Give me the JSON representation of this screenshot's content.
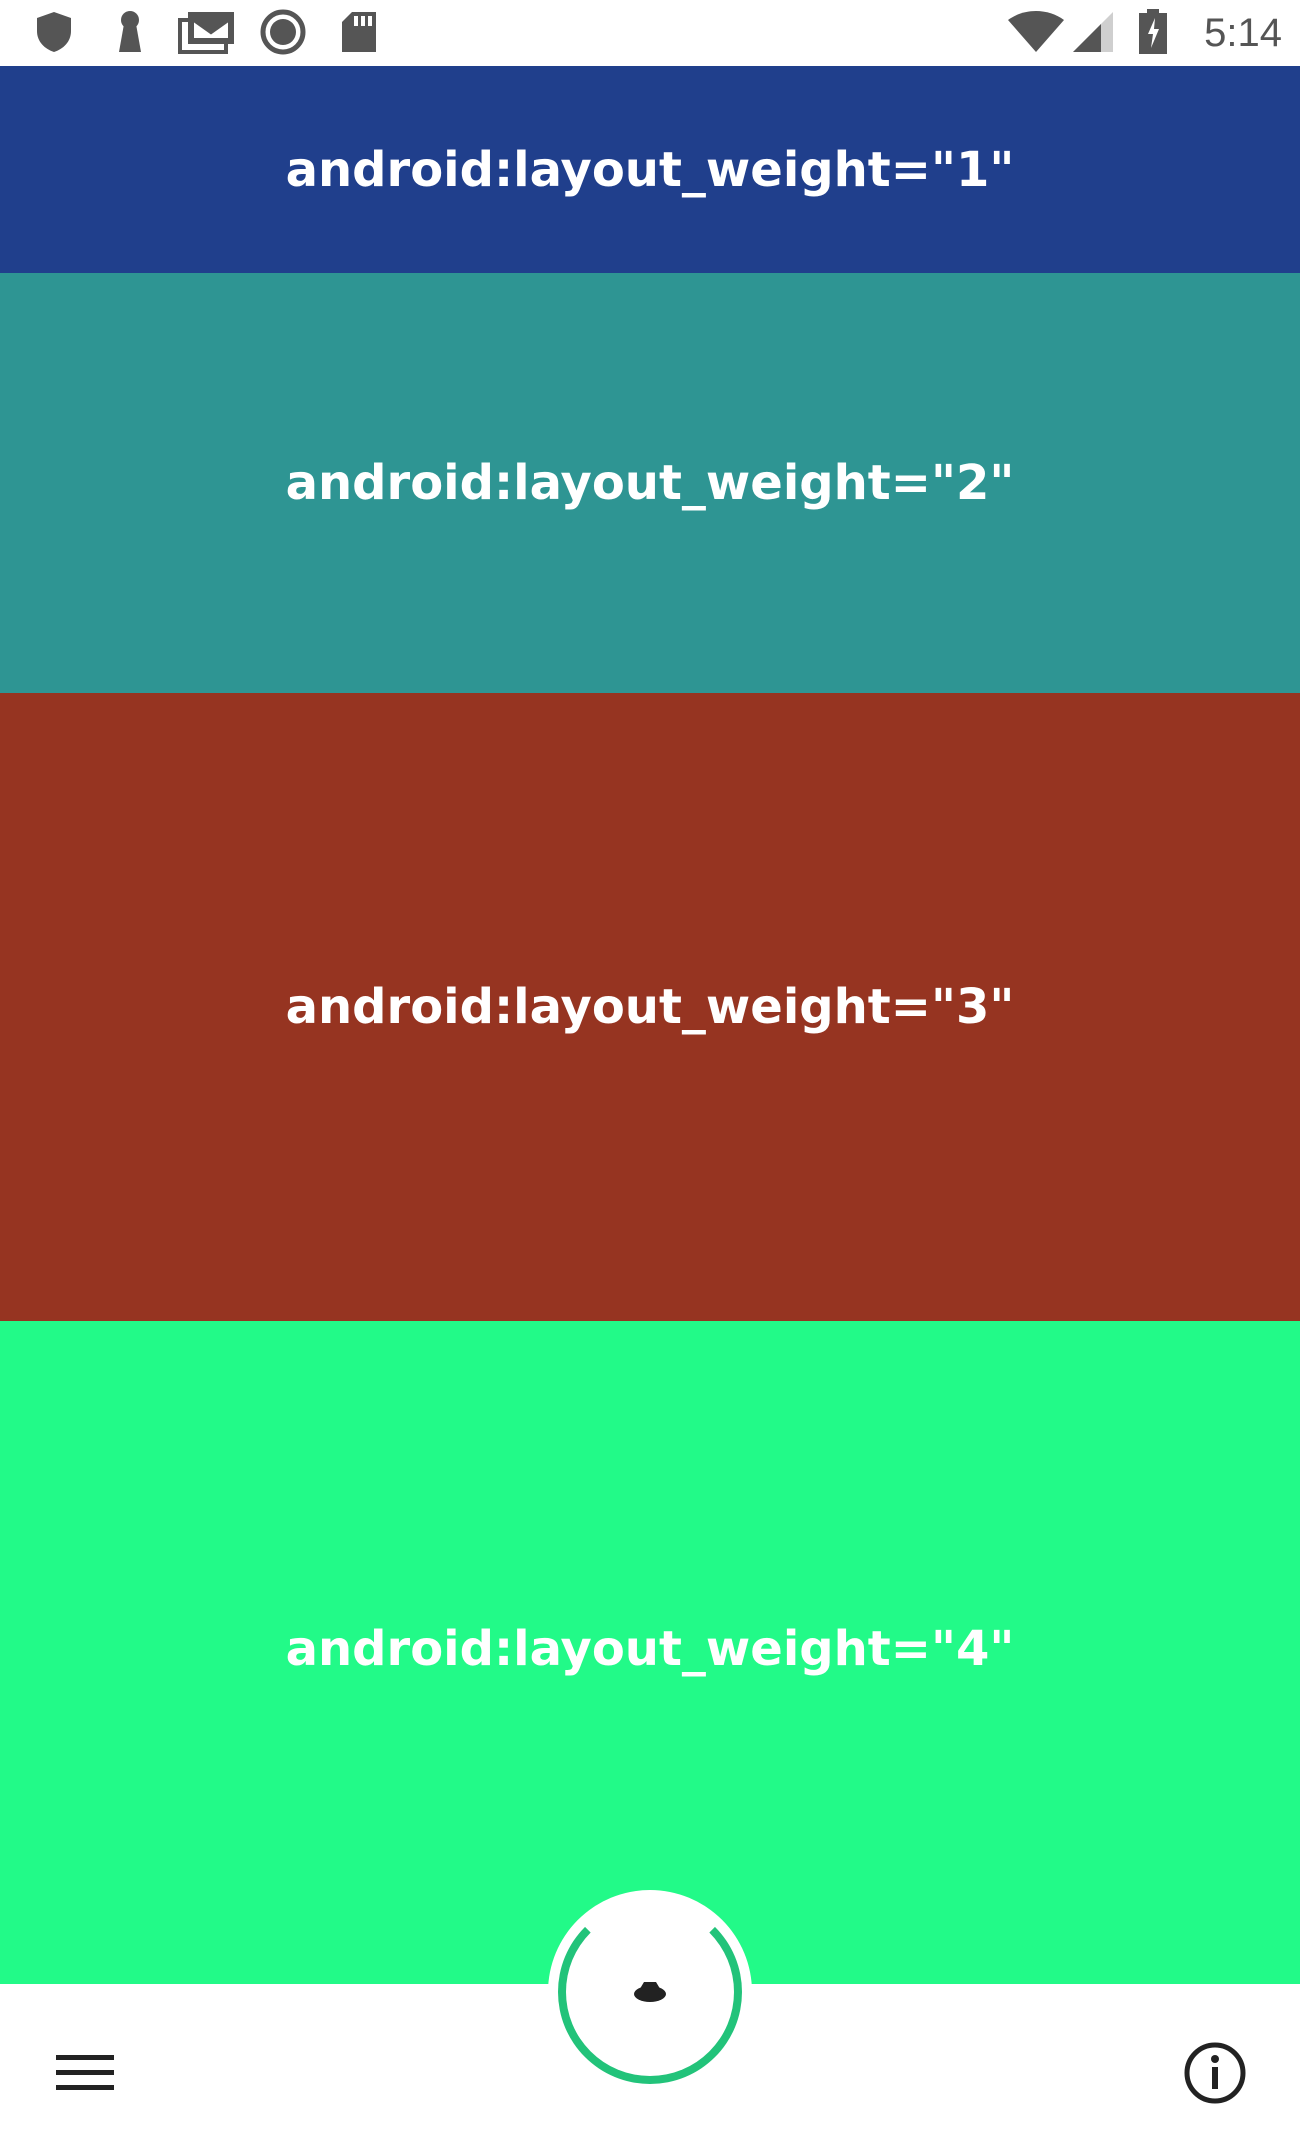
{
  "status_bar": {
    "time": "5:14",
    "icons": [
      "shield-icon",
      "keyhole-icon",
      "gmail-icon",
      "circle-icon",
      "sd-card-icon",
      "wifi-icon",
      "signal-icon",
      "battery-icon"
    ],
    "icon_color": "#555555"
  },
  "panels": [
    {
      "label": "android:layout_weight=\"1\"",
      "weight": 1,
      "color": "#203f8c"
    },
    {
      "label": "android:layout_weight=\"2\"",
      "weight": 2,
      "color": "#2e9593"
    },
    {
      "label": "android:layout_weight=\"3\"",
      "weight": 3,
      "color": "#963421"
    },
    {
      "label": "android:layout_weight=\"4\"",
      "weight": 4,
      "color": "#22fa88"
    }
  ],
  "bottom_bar": {
    "menu_icon": "menu-icon",
    "fab_icon": "fab-icon",
    "info_icon": "info-icon",
    "accent": "#22c37a"
  }
}
